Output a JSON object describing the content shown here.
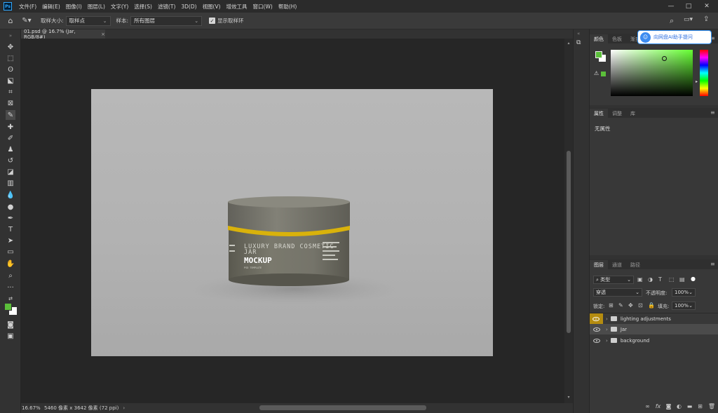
{
  "menubar": {
    "logo": "Ps",
    "items": [
      "文件(F)",
      "编辑(E)",
      "图像(I)",
      "图层(L)",
      "文字(Y)",
      "选择(S)",
      "滤镜(T)",
      "3D(D)",
      "视图(V)",
      "增效工具",
      "窗口(W)",
      "帮助(H)"
    ],
    "window_controls": [
      "—",
      "□",
      "✕"
    ]
  },
  "optionsbar": {
    "sample_size_label": "取样大小:",
    "sample_size_value": "取样点",
    "sample_label": "样本:",
    "sample_value": "所有图层",
    "show_ring_label": "显示取样环"
  },
  "document": {
    "tab_title": "01.psd @ 16.7% (Jar, RGB/8#)",
    "tab_close": "×",
    "mockup": {
      "line1": "LUXURY BRAND COSMETIC",
      "line2": "JAR",
      "line3": "MOCKUP",
      "line4": "PSD TEMPLATE"
    }
  },
  "status": {
    "zoom": "16.67%",
    "dimensions": "5460 像素 x 3642 像素 (72 ppi)",
    "arrow": "›"
  },
  "color_panel": {
    "tabs": [
      "颜色",
      "色板",
      "渐变"
    ],
    "foreground": "#5bbf3a",
    "background": "#ffffff",
    "hue_color": "#66ff33",
    "assistant_label": "向网盘AI助手提问"
  },
  "properties_panel": {
    "tabs": [
      "属性",
      "调整",
      "库"
    ],
    "empty_text": "无属性"
  },
  "layers_panel": {
    "tabs": [
      "图层",
      "通道",
      "路径"
    ],
    "filter_label": "类型",
    "blend_mode": "穿透",
    "opacity_label": "不透明度:",
    "opacity_value": "100%",
    "lock_label": "锁定:",
    "fill_label": "填充:",
    "fill_value": "100%",
    "layers": [
      {
        "name": "lighting adjustments"
      },
      {
        "name": "Jar"
      },
      {
        "name": "background"
      }
    ],
    "bottom_icons": [
      "link-icon",
      "fx-icon",
      "mask-icon",
      "adjustment-icon",
      "folder-icon",
      "new-layer-icon",
      "trash-icon"
    ],
    "fx_label": "fx"
  },
  "colors": {
    "accent_yellow": "#b58c10",
    "jar_lid": "#77766a",
    "jar_band": "#d9b20b"
  }
}
